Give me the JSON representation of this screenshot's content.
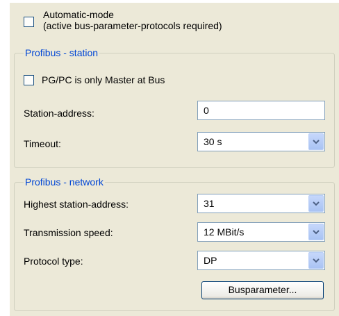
{
  "automatic_mode": {
    "label_line1": "Automatic-mode",
    "label_line2": "(active bus-parameter-protocols required)",
    "checked": false
  },
  "station_group": {
    "legend": "Profibus - station",
    "master_checkbox": {
      "label": "PG/PC is only Master at Bus",
      "checked": false
    },
    "station_address": {
      "label": "Station-address:",
      "value": "0"
    },
    "timeout": {
      "label": "Timeout:",
      "value": "30 s"
    }
  },
  "network_group": {
    "legend": "Profibus - network",
    "highest_station_address": {
      "label": "Highest station-address:",
      "value": "31"
    },
    "transmission_speed": {
      "label": "Transmission speed:",
      "value": "12 MBit/s"
    },
    "protocol_type": {
      "label": "Protocol type:",
      "value": "DP"
    },
    "busparameter_button": "Busparameter..."
  },
  "icons": {
    "dropdown": "chevron-down-icon"
  },
  "colors": {
    "legend": "#0046d5",
    "panel_bg": "#ece9d8",
    "field_border": "#7f9db9"
  }
}
